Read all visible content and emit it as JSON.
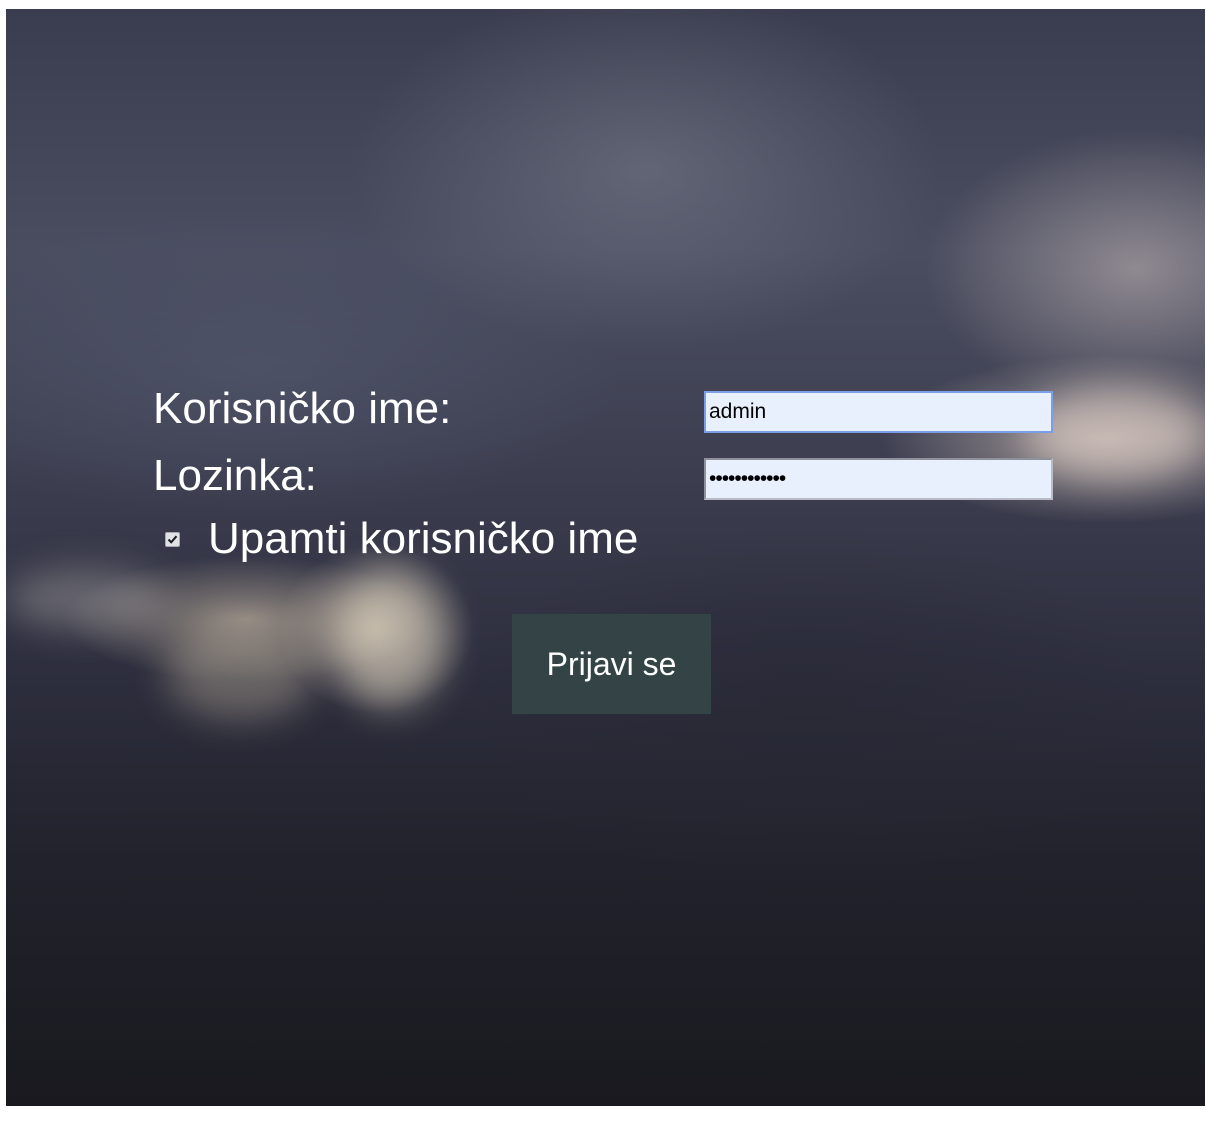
{
  "login_form": {
    "username_label": "Korisničko ime:",
    "username_value": "admin",
    "password_label": "Lozinka:",
    "password_value": "••••••••••••",
    "remember_label": "Upamti korisničko ime",
    "remember_checked": true,
    "submit_label": "Prijavi se"
  },
  "colors": {
    "button_bg": "#344446",
    "input_bg": "#e8f0fe",
    "label_text": "#ffffff"
  }
}
